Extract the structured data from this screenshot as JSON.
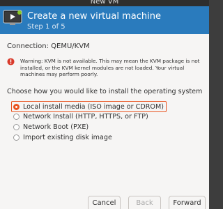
{
  "window": {
    "title": "New VM"
  },
  "header": {
    "title": "Create a new virtual machine",
    "step": "Step 1 of 5",
    "icon": "monitor-play-icon"
  },
  "connection": {
    "label": "Connection: QEMU/KVM"
  },
  "warning": {
    "icon": "warning-icon",
    "text": "Warning: KVM is not available. This may mean the KVM package is not installed, or the KVM kernel modules are not loaded. Your virtual machines may perform poorly."
  },
  "install": {
    "prompt": "Choose how you would like to install the operating system",
    "options": [
      {
        "label": "Local install media (ISO image or CDROM)",
        "selected": true
      },
      {
        "label": "Network Install (HTTP, HTTPS, or FTP)",
        "selected": false
      },
      {
        "label": "Network Boot (PXE)",
        "selected": false
      },
      {
        "label": "Import existing disk image",
        "selected": false
      }
    ]
  },
  "buttons": {
    "cancel": "Cancel",
    "back": "Back",
    "forward": "Forward"
  },
  "colors": {
    "accent": "#e95420",
    "header": "#2a7bbd"
  }
}
